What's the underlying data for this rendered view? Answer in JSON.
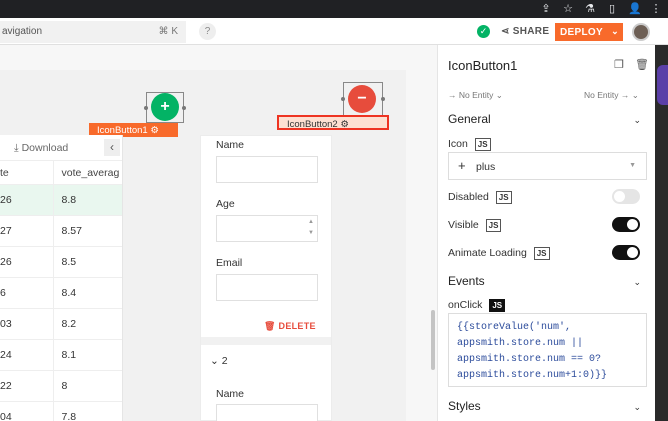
{
  "header": {
    "nav_text": "avigation",
    "nav_shortcut": "⌘ K",
    "help": "?",
    "share": "SHARE",
    "deploy": "DEPLOY",
    "deploy_caret": "⌄"
  },
  "canvas": {
    "widgets": [
      {
        "label": "IconButton1",
        "icon": "+"
      },
      {
        "label": "IconButton2",
        "icon": "−"
      }
    ],
    "table": {
      "download": "Download",
      "columns": [
        "te",
        "vote_averag"
      ],
      "rows": [
        [
          "26",
          "8.8"
        ],
        [
          "27",
          "8.57"
        ],
        [
          "26",
          "8.5"
        ],
        [
          "6",
          "8.4"
        ],
        [
          "03",
          "8.2"
        ],
        [
          "24",
          "8.1"
        ],
        [
          "22",
          "8"
        ],
        [
          "04",
          "7.8"
        ]
      ]
    },
    "form": {
      "name_label": "Name",
      "age_label": "Age",
      "email_label": "Email",
      "delete": "DELETE",
      "item2_number": "2",
      "item2_name_label": "Name"
    }
  },
  "property_pane": {
    "title": "IconButton1",
    "entity_left": "No Entity",
    "entity_right": "No Entity",
    "general": "General",
    "icon_label": "Icon",
    "js": "JS",
    "icon_value": "plus",
    "disabled_label": "Disabled",
    "visible_label": "Visible",
    "animate_label": "Animate Loading",
    "events": "Events",
    "onclick_label": "onClick",
    "code_lines": [
      "{{storeValue('num',",
      "appsmith.store.num ||",
      "appsmith.store.num == 0?",
      "appsmith.store.num+1:0)}}"
    ],
    "styles": "Styles",
    "toggles": {
      "disabled": false,
      "visible": true,
      "animate_loading": true
    }
  },
  "colors": {
    "deploy": "#f86a2b",
    "plus_button": "#03b365",
    "minus_button": "#e74c3c",
    "code_text": "#2b4b9b"
  }
}
